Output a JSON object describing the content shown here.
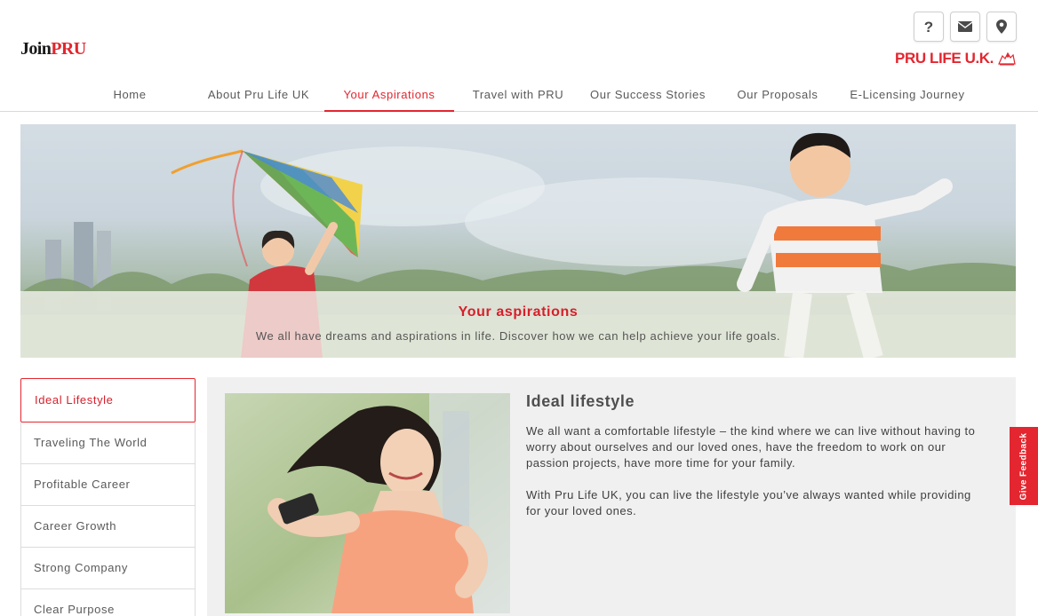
{
  "header": {
    "logo_prefix": "Join",
    "logo_suffix": "PRU",
    "brand": "PRU LIFE U.K.",
    "icon_buttons": [
      {
        "icon": "help-icon",
        "glyph": "?"
      },
      {
        "icon": "mail-icon",
        "glyph": "✉"
      },
      {
        "icon": "location-icon",
        "glyph": "⚲"
      }
    ]
  },
  "nav": {
    "items": [
      {
        "label": "Home"
      },
      {
        "label": "About Pru Life UK"
      },
      {
        "label": "Your Aspirations"
      },
      {
        "label": "Travel with PRU"
      },
      {
        "label": "Our Success Stories"
      },
      {
        "label": "Our Proposals"
      },
      {
        "label": "E-Licensing Journey"
      }
    ],
    "active_index": 2
  },
  "hero": {
    "title": "Your aspirations",
    "subtitle": "We all have dreams and aspirations in life. Discover how we can help achieve your life goals."
  },
  "sidebar": {
    "items": [
      {
        "label": "Ideal Lifestyle"
      },
      {
        "label": "Traveling The World"
      },
      {
        "label": "Profitable Career"
      },
      {
        "label": "Career Growth"
      },
      {
        "label": "Strong Company"
      },
      {
        "label": "Clear Purpose"
      }
    ],
    "active_index": 0
  },
  "content": {
    "title": "Ideal lifestyle",
    "paragraphs": [
      "We all want a comfortable lifestyle – the kind where we can live without having to worry about ourselves and our loved ones, have the freedom to work on our passion projects, have more time for your family.",
      "With Pru Life UK, you can live the lifestyle you’ve always wanted while providing for your loved ones."
    ]
  },
  "feedback": {
    "label": "Give Feedback"
  },
  "colors": {
    "accent": "#e3262f",
    "panel": "#f0f0f0",
    "border": "#dcdcdc"
  }
}
